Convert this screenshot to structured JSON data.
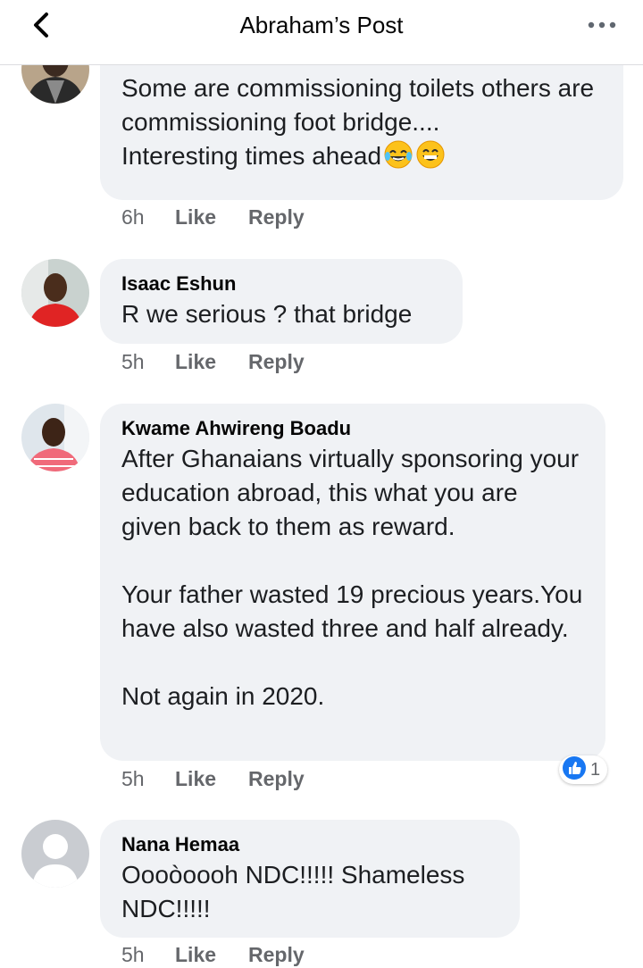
{
  "header": {
    "title": "Abraham’s Post",
    "back_icon": "chevron-left-icon",
    "more_icon": "more-horizontal-icon"
  },
  "comments": [
    {
      "name": "",
      "text": "Some are commissioning toilets others are commissioning foot bridge....\nInteresting times ahead",
      "emojis": [
        "tears-of-joy-emoji",
        "grinning-emoji"
      ],
      "time": "6h",
      "like": "Like",
      "reply": "Reply"
    },
    {
      "name": "Isaac Eshun",
      "text": "R we serious ? that bridge",
      "time": "5h",
      "like": "Like",
      "reply": "Reply"
    },
    {
      "name": "Kwame Ahwireng Boadu",
      "text": "After Ghanaians virtually sponsoring your education abroad, this what you are given back to them as reward.\n\nYour father wasted 19 precious years.You have also wasted three and half already.\n\nNot again in 2020.",
      "time": "5h",
      "like": "Like",
      "reply": "Reply",
      "reaction": {
        "icon": "thumbs-up-icon",
        "count": "1"
      }
    },
    {
      "name": "Nana Hemaa",
      "text": "Oooòoooh NDC!!!!! Shameless NDC!!!!!",
      "time": "5h",
      "like": "Like",
      "reply": "Reply"
    }
  ],
  "colors": {
    "bubble": "#f0f2f5",
    "meta": "#65676b",
    "like_blue": "#1877f2"
  }
}
